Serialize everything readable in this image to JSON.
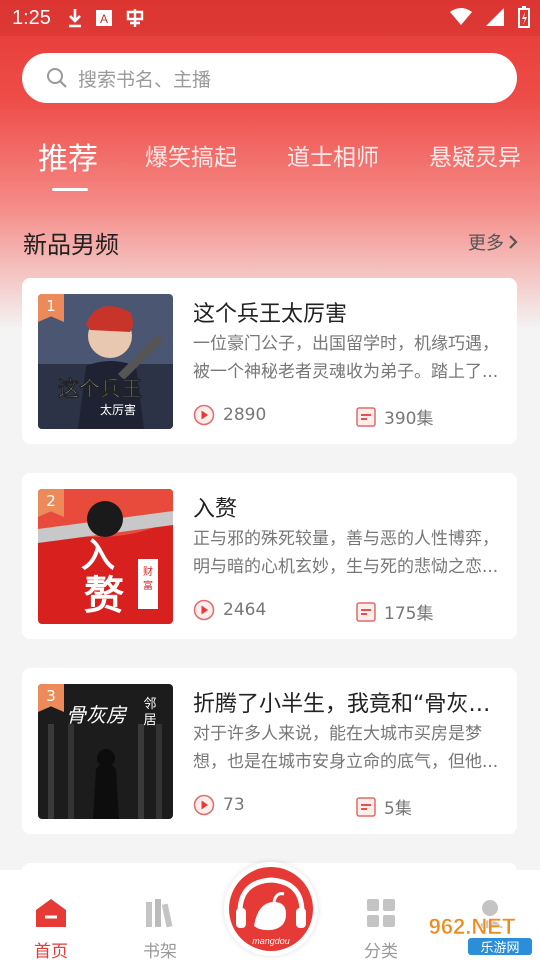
{
  "status_bar": {
    "time": "1:25",
    "icons": [
      "download-icon",
      "notification-a-icon",
      "app-icon"
    ],
    "right_icons": [
      "wifi-icon",
      "signal-icon",
      "battery-icon"
    ]
  },
  "search": {
    "placeholder": "搜索书名、主播"
  },
  "tabs": [
    {
      "label": "推荐",
      "active": true
    },
    {
      "label": "爆笑搞起",
      "active": false
    },
    {
      "label": "道士相师",
      "active": false
    },
    {
      "label": "悬疑灵异",
      "active": false
    }
  ],
  "section": {
    "title": "新品男频",
    "more": "更多"
  },
  "books": [
    {
      "rank": "1",
      "title": "这个兵王太厉害",
      "desc": "一位豪门公子，出国留学时，机缘巧遇，被一个神秘老者灵魂收为弟子。踏上了...",
      "plays": "2890",
      "episodes": "390集",
      "cover_text": "这个兵王",
      "cover_sub": "太厉害",
      "cover_color": "#5a6a86"
    },
    {
      "rank": "2",
      "title": "入赘",
      "desc": "正与邪的殊死较量，善与恶的人性博弈，明与暗的心机玄妙，生与死的悲恸之恋...",
      "plays": "2464",
      "episodes": "175集",
      "cover_text": "入赘",
      "cover_sub": "财富至尊",
      "cover_color": "#d8201f"
    },
    {
      "rank": "3",
      "title": "折腾了小半生，我竟和“骨灰房...",
      "desc": "对于许多人来说，能在大城市买房是梦想，也是在城市安身立命的底气，但他...",
      "plays": "73",
      "episodes": "5集",
      "cover_text": "骨灰房",
      "cover_sub": "邻居",
      "cover_color": "#2a2a2a"
    }
  ],
  "bottom_nav": [
    {
      "label": "首页",
      "active": true
    },
    {
      "label": "书架",
      "active": false
    },
    {
      "label": "分类",
      "active": false
    },
    {
      "label": "",
      "active": false
    }
  ],
  "center_logo": "mangdou",
  "watermark": {
    "main": "962.NET",
    "sub": "乐游网"
  },
  "colors": {
    "accent": "#e53a36",
    "rank_badge": "#ec8a5a"
  }
}
